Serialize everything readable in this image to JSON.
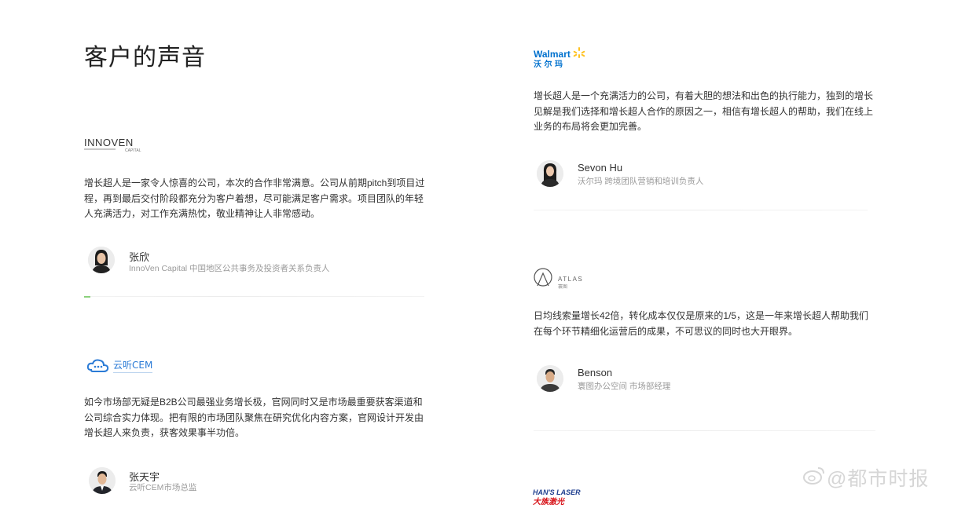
{
  "page": {
    "title": "客户的声音"
  },
  "testimonials": [
    {
      "logo": {
        "lines": [
          "INNOVEN",
          "CAPITAL"
        ],
        "icon": "innoven-logo"
      },
      "quote": "增长超人是一家令人惊喜的公司，本次的合作非常满意。公司从前期pitch到项目过程，再到最后交付阶段都充分为客户着想，尽可能满足客户需求。项目团队的年轻人充满活力，对工作充满热忱，敬业精神让人非常感动。",
      "name": "张欣",
      "role": "InnoVen Capital 中国地区公共事务及投资者关系负责人"
    },
    {
      "logo": {
        "lines": [
          "云听CEM"
        ],
        "icon": "cloud-icon"
      },
      "quote": "如今市场部无疑是B2B公司最强业务增长极，官网同时又是市场最重要获客渠道和公司综合实力体现。把有限的市场团队聚焦在研究优化内容方案，官网设计开发由增长超人来负责，获客效果事半功倍。",
      "name": "张天宇",
      "role": "云听CEM市场总监"
    },
    {
      "logo": {
        "lines": [
          "Walmart",
          "沃 尔 玛"
        ],
        "icon": "walmart-spark-icon"
      },
      "quote": "增长超人是一个充满活力的公司，有着大胆的想法和出色的执行能力，独到的增长见解是我们选择和增长超人合作的原因之一，相信有增长超人的帮助，我们在线上业务的布局将会更加完善。",
      "name": "Sevon Hu",
      "role": "沃尔玛 跨境团队营销和培训负责人"
    },
    {
      "logo": {
        "lines": [
          "ATLAS",
          "寰图"
        ],
        "icon": "atlas-logo"
      },
      "quote": "日均线索量增长42倍，转化成本仅仅是原来的1/5，这是一年来增长超人帮助我们在每个环节精细化运营后的成果，不可思议的同时也大开眼界。",
      "name": "Benson",
      "role": "寰图办公空间 市场部经理"
    },
    {
      "logo": {
        "lines": [
          "HAN'S LASER",
          "大族激光"
        ],
        "icon": "hans-laser-logo"
      }
    }
  ],
  "watermark": "@都市时报",
  "colors": {
    "walmart_blue": "#0071ce",
    "walmart_yellow": "#ffc220",
    "hans_red": "#d7141a",
    "hans_blue": "#1f3f8f",
    "cloud_blue": "#2b7bd6"
  }
}
